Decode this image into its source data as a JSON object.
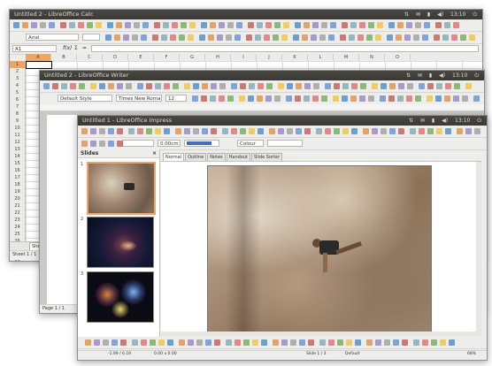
{
  "calc": {
    "title": "Untitled 2 - LibreOffice Calc",
    "font_name": "Arial",
    "cell_ref": "A1",
    "formula_icons": [
      "f(x)",
      "Σ",
      "="
    ],
    "columns": [
      "A",
      "B",
      "C",
      "D",
      "E",
      "F",
      "G",
      "H",
      "I",
      "J",
      "K",
      "L",
      "M",
      "N",
      "O"
    ],
    "rows": [
      "1",
      "2",
      "3",
      "4",
      "5",
      "6",
      "7",
      "8",
      "9",
      "10",
      "11",
      "12",
      "13",
      "14",
      "15",
      "16",
      "17",
      "18",
      "19",
      "20",
      "21",
      "22",
      "23",
      "24",
      "25",
      "26",
      "27",
      "28",
      "29",
      "30",
      "31",
      "32",
      "33"
    ],
    "sheet_tab": "Sheet1",
    "status": "Sheet 1 / 1"
  },
  "writer": {
    "title": "Untitled 2 - LibreOffice Writer",
    "paragraph_style": "Default Style",
    "font_name": "Times New Roman",
    "font_size": "12",
    "status": "Page 1 / 1"
  },
  "impress": {
    "title": "Untitled 1 - LibreOffice Impress",
    "line_width": "0.00cm",
    "area_style": "Colour",
    "slides_panel_title": "Slides",
    "slides_close": "×",
    "view_tabs": [
      "Normal",
      "Outline",
      "Notes",
      "Handout",
      "Slide Sorter"
    ],
    "slide_numbers": [
      "1",
      "2",
      "3"
    ],
    "status_position": "-1.99 / 6.19",
    "status_size": "0.00 x 0.00",
    "status_slide": "Slide 1 / 3",
    "status_layout": "Default",
    "status_zoom": "68%"
  },
  "system_tray": {
    "time": "13:10"
  },
  "colors": {
    "titlebar": "#3c3b37",
    "selection": "#f2a35e",
    "window_bg": "#ededeb"
  },
  "icons": [
    "network-icon",
    "mail-icon",
    "battery-icon",
    "volume-icon",
    "power-icon"
  ]
}
